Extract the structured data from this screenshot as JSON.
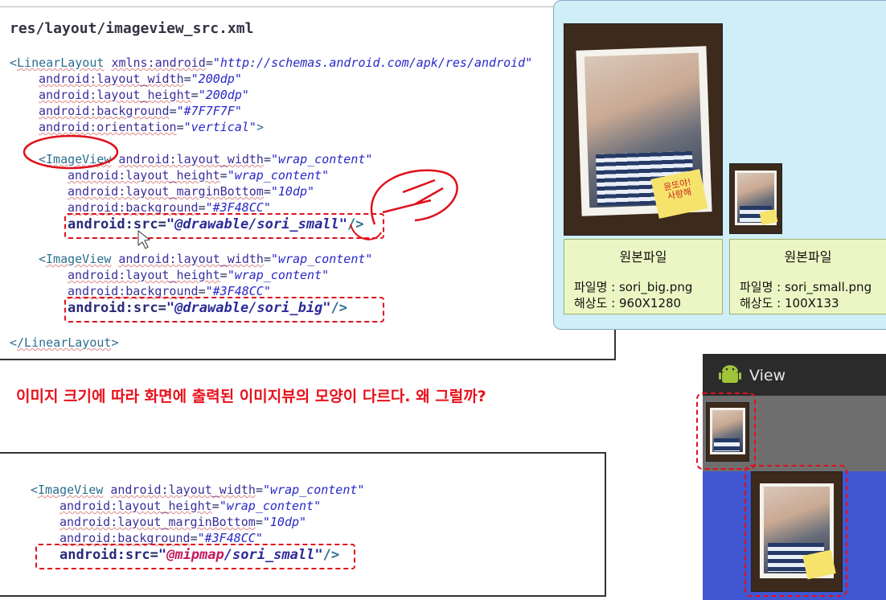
{
  "code_top": {
    "title": "res/layout/imageview_src.xml",
    "lines": [
      {
        "t": "<",
        "tag": "LinearLayout",
        "rest_attr": "xmlns:android",
        "rest_val": "\"http://schemas.android.com/apk/res/android\""
      },
      {
        "attr": "android:layout_width",
        "val": "\"200dp\""
      },
      {
        "attr": "android:layout_height",
        "val": "\"200dp\""
      },
      {
        "attr": "android:background",
        "val": "\"#7F7F7F\""
      },
      {
        "attr": "android:orientation",
        "val": "\"vertical\"",
        "end": ">"
      },
      {
        "tag": "ImageView",
        "attr": "android:layout_width",
        "val": "\"wrap_content\""
      },
      {
        "attr": "android:layout_height",
        "val": "\"wrap_content\""
      },
      {
        "attr": "android:layout_marginBottom",
        "val": "\"10dp\""
      },
      {
        "attr": "android:background",
        "val": "\"#3F48CC\""
      },
      {
        "attr": "android:src",
        "val": "\"@drawable/sori_small\"",
        "end": "/>"
      },
      {
        "tag": "ImageView",
        "attr": "android:layout_width",
        "val": "\"wrap_content\""
      },
      {
        "attr": "android:layout_height",
        "val": "\"wrap_content\""
      },
      {
        "attr": "android:background",
        "val": "\"#3F48CC\""
      },
      {
        "attr": "android:src",
        "val": "\"@drawable/sori_big\"",
        "end": "/>"
      },
      {
        "tag": "/LinearLayout",
        "end": ">"
      }
    ]
  },
  "question": "이미지 크기에 따라 화면에 출력된 이미지뷰의 모양이 다르다.  왜 그럴까?",
  "code_bottom": {
    "lines": [
      {
        "tag": "ImageView",
        "attr": "android:layout_width",
        "val": "\"wrap_content\""
      },
      {
        "attr": "android:layout_height",
        "val": "\"wrap_content\""
      },
      {
        "attr": "android:layout_marginBottom",
        "val": "\"10dp\""
      },
      {
        "attr": "android:background",
        "val": "\"#3F48CC\""
      },
      {
        "attr": "android:src",
        "val_pre": "\"",
        "val_pink": "@mipmap",
        "val_post": "/sori_small\"",
        "end": "/>"
      }
    ]
  },
  "preview": {
    "big_note": "윤또야!\n사랑해",
    "cards": [
      {
        "heading": "원본파일",
        "filename": "파일명 : sori_big.png",
        "resolution": "해상도 : 960X1280"
      },
      {
        "heading": "원본파일",
        "filename": "파일명 : sori_small.png",
        "resolution": "해상도 : 100X133"
      }
    ]
  },
  "emulator": {
    "title": "View",
    "colors": {
      "gray": "#7F7F7F",
      "blue": "#3F48CC"
    }
  },
  "colors": {
    "highlight": "#e0101a",
    "question": "#e8101a"
  }
}
